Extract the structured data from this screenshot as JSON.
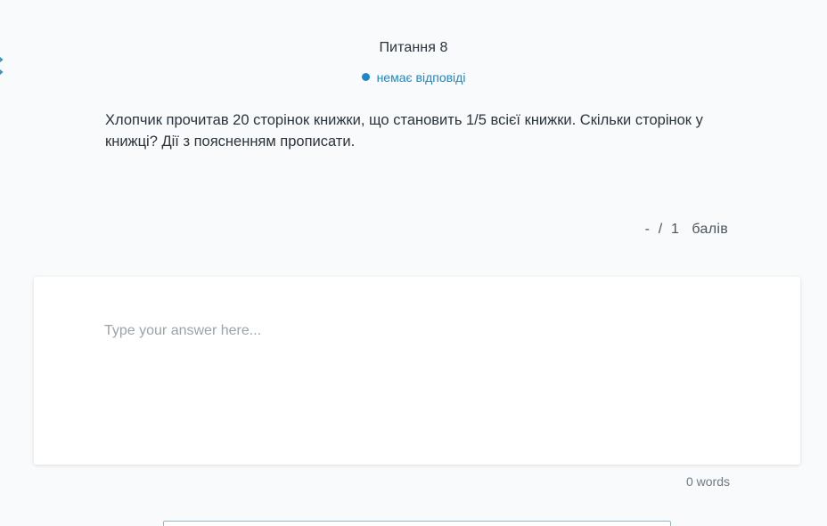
{
  "question": {
    "title": "Питання 8",
    "status": "немає відповіді",
    "text": "Хлопчик прочитав 20 сторінок книжки, що становить 1/5 всієї книжки. Скільки сторінок у книжці? Дії з поясненням прописати."
  },
  "points": {
    "display": "-  /  1   балів"
  },
  "answer": {
    "value": "",
    "placeholder": "Type your answer here..."
  },
  "word_count": "0 words",
  "colors": {
    "accent": "#1e88c7",
    "text": "#2b333b",
    "background": "#f8fafc"
  },
  "icons": {
    "edge": "arrows-icon",
    "status": "status-dot-icon"
  }
}
